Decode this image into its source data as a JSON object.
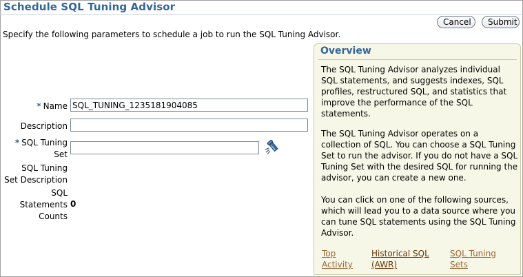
{
  "header": {
    "title": "Schedule SQL Tuning Advisor"
  },
  "actions": {
    "cancel_label": "Cancel",
    "submit_label": "Submit"
  },
  "instruction": "Specify the following parameters to schedule a job to run the SQL Tuning Advisor.",
  "form": {
    "required_marker": "*",
    "name_label": "Name",
    "name_value": "SQL_TUNING_1235181904085",
    "description_label": "Description",
    "description_value": "",
    "tuning_set_label_line1": "SQL Tuning",
    "tuning_set_label_line2": "Set",
    "tuning_set_value": "",
    "tuning_set_desc_label_line1": "SQL Tuning",
    "tuning_set_desc_label_line2": "Set Description",
    "statements_label_line1": "SQL",
    "statements_label_line2": "Statements",
    "statements_label_line3": "Counts",
    "statements_count": "0",
    "search_icon": "flashlight-search-icon"
  },
  "overview": {
    "title": "Overview",
    "paragraph1": "The SQL Tuning Advisor analyzes individual SQL statements, and suggests indexes, SQL profiles, restructured SQL, and statistics that improve the performance of the SQL statements.",
    "paragraph2": "The SQL Tuning Advisor operates on a collection of SQL. You can choose a SQL Tuning Set to run the advisor. If you do not have a SQL Tuning Set with the desired SQL for running the advisor, you can create a new one.",
    "paragraph3": "You can click on one of the following sources, which will lead you to a data source where you can tune SQL statements using the SQL Tuning Advisor.",
    "links": [
      {
        "line1": "Top",
        "line2": "Activity"
      },
      {
        "line1": "Historical SQL",
        "line2": "(AWR)"
      },
      {
        "line1": "SQL Tuning",
        "line2": "Sets"
      }
    ]
  },
  "colors": {
    "title_blue": "#336699",
    "link_brown": "#996633",
    "overview_bg": "#f7f7e7"
  }
}
